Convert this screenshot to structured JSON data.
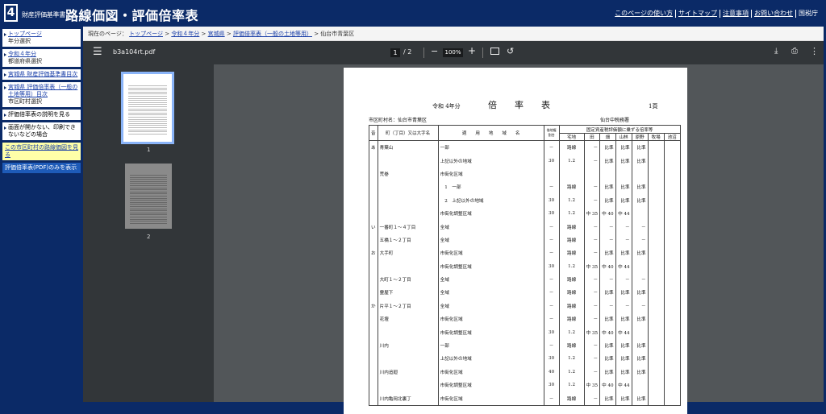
{
  "header": {
    "logo_digit": "4",
    "site_name": "財産評価基準書",
    "title": "路線価図・評価倍率表",
    "links": [
      "このページの使い方",
      "サイトマップ",
      "注意事項",
      "お問い合わせ"
    ],
    "lang": "国税庁"
  },
  "sidebar": {
    "items": [
      {
        "link": "トップページ",
        "sub": "年分選択"
      },
      {
        "link": "令和４年分",
        "sub": "都道府県選択"
      },
      {
        "link": "宮城県 財産評価基準書目次",
        "sub": ""
      },
      {
        "link": "宮城県 評価倍率表（一般の土地等用）目次",
        "sub": "市区町村選択"
      }
    ],
    "plain": [
      "評価倍率表の説明を見る",
      "画面が開かない、印刷できないなどの場合"
    ],
    "yellow": "この市区町村の路線価図を見る",
    "blue": "評価倍率表(PDF)のみを表示"
  },
  "breadcrumb": {
    "prefix": "現在のページ：",
    "items": [
      "トップページ",
      "令和４年分",
      "宮城県",
      "評価倍率表（一般の土地等用）"
    ],
    "current": "仙台市青葉区"
  },
  "viewer": {
    "filename": "b3a104rt.pdf",
    "page": "1",
    "pages": "/ 2",
    "zoom": "100%",
    "thumb_labels": [
      "1",
      "2"
    ]
  },
  "doc": {
    "year": "令和 4年分",
    "title": "倍　　率　　表",
    "page_no": "1頁",
    "city": "市区町村名：仙台市青葉区",
    "office": "仙台中税務署",
    "col_headers": {
      "on": "音",
      "town": "町（丁目）又は大字名",
      "area": "適　　用　　地　　域　　名",
      "lease": "借地権割合",
      "fixed": "固定資産税評価額に乗ずる倍率等",
      "taku": "宅地",
      "ta": "田",
      "hata": "畑",
      "sanrin": "山林",
      "genya": "原野",
      "bokujo": "牧場",
      "ike": "池沼"
    },
    "rows": [
      {
        "on": "あ",
        "town": "青葉山",
        "area": "一部",
        "lease": "－",
        "taku": "路線",
        "ta": "－",
        "hata": "比準",
        "sanrin": "比準",
        "genya": "比準"
      },
      {
        "on": "",
        "town": "",
        "area": "上記以外の地域",
        "lease": "30",
        "taku": "1.2",
        "ta": "－",
        "hata": "比準",
        "sanrin": "比準",
        "genya": "比準"
      },
      {
        "on": "",
        "town": "荒巻",
        "area": "市街化区域",
        "lease": "",
        "taku": "",
        "ta": "",
        "hata": "",
        "sanrin": "",
        "genya": ""
      },
      {
        "on": "",
        "town": "",
        "area": "　1　一部",
        "lease": "－",
        "taku": "路線",
        "ta": "－",
        "hata": "比準",
        "sanrin": "比準",
        "genya": "比準"
      },
      {
        "on": "",
        "town": "",
        "area": "　2　上記以外の地域",
        "lease": "30",
        "taku": "1.2",
        "ta": "－",
        "hata": "比準",
        "sanrin": "比準",
        "genya": "比準"
      },
      {
        "on": "",
        "town": "",
        "area": "市街化調整区域",
        "lease": "30",
        "taku": "1.2",
        "ta": "中 35",
        "hata": "中 40",
        "sanrin": "中 44",
        "genya": ""
      },
      {
        "on": "い",
        "town": "一番町１～４丁目",
        "area": "全域",
        "lease": "－",
        "taku": "路線",
        "ta": "－",
        "hata": "－",
        "sanrin": "－",
        "genya": "－"
      },
      {
        "on": "",
        "town": "五橋１～２丁目",
        "area": "全域",
        "lease": "－",
        "taku": "路線",
        "ta": "－",
        "hata": "－",
        "sanrin": "－",
        "genya": "－"
      },
      {
        "on": "お",
        "town": "大手町",
        "area": "市街化区域",
        "lease": "－",
        "taku": "路線",
        "ta": "－",
        "hata": "比準",
        "sanrin": "比準",
        "genya": "比準"
      },
      {
        "on": "",
        "town": "",
        "area": "市街化調整区域",
        "lease": "30",
        "taku": "1.2",
        "ta": "中 35",
        "hata": "中 40",
        "sanrin": "中 44",
        "genya": ""
      },
      {
        "on": "",
        "town": "大町１～２丁目",
        "area": "全域",
        "lease": "－",
        "taku": "路線",
        "ta": "－",
        "hata": "－",
        "sanrin": "－",
        "genya": "－"
      },
      {
        "on": "",
        "town": "霊屋下",
        "area": "全域",
        "lease": "－",
        "taku": "路線",
        "ta": "－",
        "hata": "比準",
        "sanrin": "比準",
        "genya": "比準"
      },
      {
        "on": "か",
        "town": "片平１～２丁目",
        "area": "全域",
        "lease": "－",
        "taku": "路線",
        "ta": "－",
        "hata": "－",
        "sanrin": "－",
        "genya": "－"
      },
      {
        "on": "",
        "town": "花壇",
        "area": "市街化区域",
        "lease": "－",
        "taku": "路線",
        "ta": "－",
        "hata": "比準",
        "sanrin": "比準",
        "genya": "比準"
      },
      {
        "on": "",
        "town": "",
        "area": "市街化調整区域",
        "lease": "30",
        "taku": "1.2",
        "ta": "中 35",
        "hata": "中 40",
        "sanrin": "中 44",
        "genya": ""
      },
      {
        "on": "",
        "town": "川内",
        "area": "一部",
        "lease": "－",
        "taku": "路線",
        "ta": "－",
        "hata": "比準",
        "sanrin": "比準",
        "genya": "比準"
      },
      {
        "on": "",
        "town": "",
        "area": "上記以外の地域",
        "lease": "30",
        "taku": "1.2",
        "ta": "－",
        "hata": "比準",
        "sanrin": "比準",
        "genya": "比準"
      },
      {
        "on": "",
        "town": "川内追廻",
        "area": "市街化区域",
        "lease": "40",
        "taku": "1.2",
        "ta": "－",
        "hata": "比準",
        "sanrin": "比準",
        "genya": "比準"
      },
      {
        "on": "",
        "town": "",
        "area": "市街化調整区域",
        "lease": "30",
        "taku": "1.2",
        "ta": "中 35",
        "hata": "中 40",
        "sanrin": "中 44",
        "genya": ""
      },
      {
        "on": "",
        "town": "川内亀岡北裏丁",
        "area": "市街化区域",
        "lease": "－",
        "taku": "路線",
        "ta": "－",
        "hata": "比準",
        "sanrin": "比準",
        "genya": "比準"
      }
    ]
  }
}
